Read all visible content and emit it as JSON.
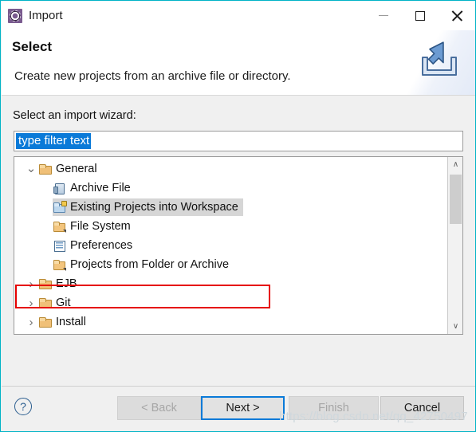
{
  "window": {
    "title": "Import",
    "icon": "eclipse-wizard-gear-icon",
    "controls": {
      "minimize": "–",
      "maximize": "□",
      "close": "✕"
    },
    "accent_border": "#00b3c6"
  },
  "header": {
    "title": "Select",
    "description": "Create new projects from an archive file or directory.",
    "banner_icon": "import-arrow-tray-icon"
  },
  "form": {
    "wizard_label": "Select an import wizard:",
    "filter": {
      "value": "type filter text",
      "placeholder": "type filter text",
      "selected": true,
      "selection_color": "#0a7ad8"
    }
  },
  "tree": {
    "items": [
      {
        "label": "General",
        "icon": "folder-open-icon",
        "indent": 0,
        "expander": "ⱟ",
        "expanded": true,
        "selected": false
      },
      {
        "label": "Archive File",
        "icon": "archive-file-icon",
        "indent": 1,
        "expander": "",
        "expanded": false,
        "selected": false
      },
      {
        "label": "Existing Projects into Workspace",
        "icon": "project-import-icon",
        "indent": 1,
        "expander": "",
        "expanded": false,
        "selected": true
      },
      {
        "label": "File System",
        "icon": "folder-arrow-icon",
        "indent": 1,
        "expander": "",
        "expanded": false,
        "selected": false
      },
      {
        "label": "Preferences",
        "icon": "preferences-document-icon",
        "indent": 1,
        "expander": "",
        "expanded": false,
        "selected": false
      },
      {
        "label": "Projects from Folder or Archive",
        "icon": "folder-arrow-icon",
        "indent": 1,
        "expander": "",
        "expanded": false,
        "selected": false
      },
      {
        "label": "EJB",
        "icon": "folder-open-icon",
        "indent": 0,
        "expander": "›",
        "expanded": false,
        "selected": false
      },
      {
        "label": "Git",
        "icon": "folder-open-icon",
        "indent": 0,
        "expander": "›",
        "expanded": false,
        "selected": false
      },
      {
        "label": "Install",
        "icon": "folder-open-icon",
        "indent": 0,
        "expander": "›",
        "expanded": false,
        "selected": false
      }
    ],
    "scrollbar": {
      "up_arrow": "∧",
      "down_arrow": "∨"
    }
  },
  "annotation": {
    "color": "#e60000",
    "target": "Existing Projects into Workspace"
  },
  "footer": {
    "help": "?",
    "buttons": [
      {
        "id": "back",
        "label": "< Back",
        "state": "disabled"
      },
      {
        "id": "next",
        "label": "Next >",
        "state": "focused"
      },
      {
        "id": "finish",
        "label": "Finish",
        "state": "disabled"
      },
      {
        "id": "cancel",
        "label": "Cancel",
        "state": "enabled"
      }
    ]
  },
  "watermark": "https://blog.csdn.net/qq_42750497"
}
